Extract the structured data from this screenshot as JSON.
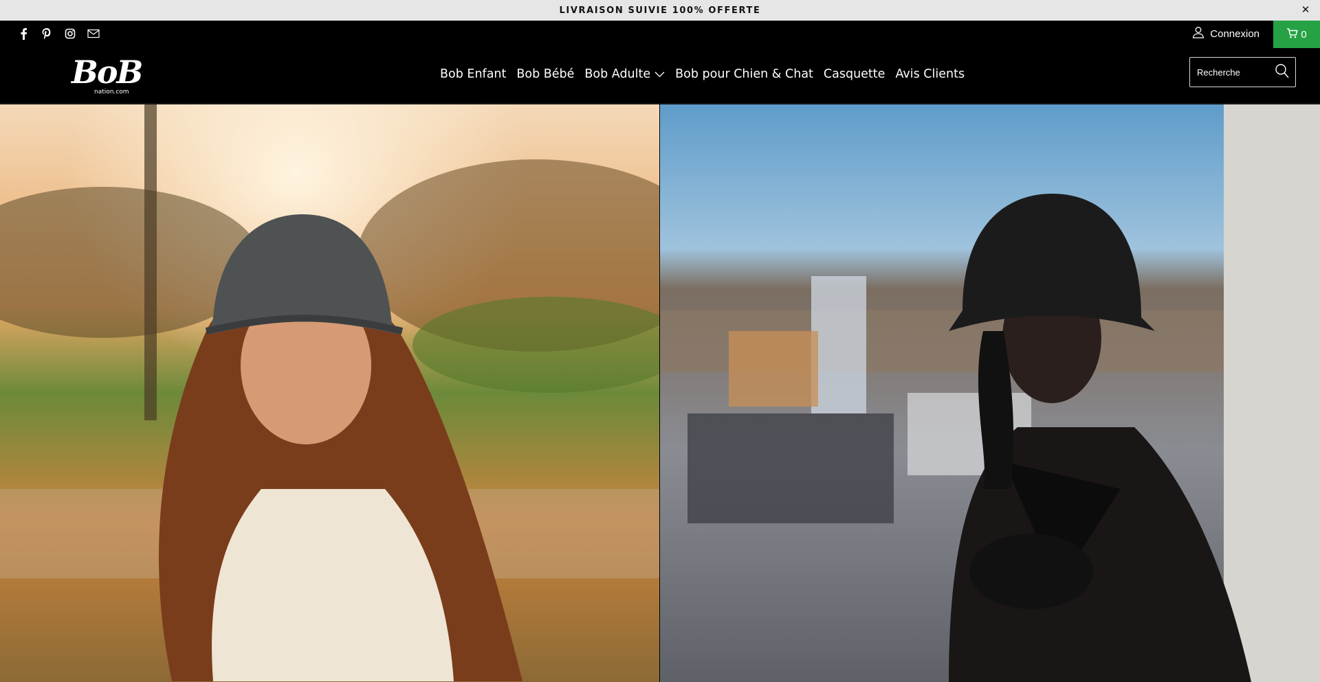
{
  "announcement": {
    "text": "LIVRAISON SUIVIE 100% OFFERTE",
    "close": "✕"
  },
  "topbar": {
    "social_icons": [
      "facebook-icon",
      "pinterest-icon",
      "instagram-icon",
      "mail-icon"
    ],
    "login_label": "Connexion",
    "cart_count": "0",
    "cart_color": "#25a244"
  },
  "header": {
    "logo_text": "BoB",
    "logo_sub": "nation.com",
    "nav": [
      {
        "label": "Bob Enfant"
      },
      {
        "label": "Bob Bébé"
      },
      {
        "label": "Bob Adulte"
      },
      {
        "label": "Bob pour Chien & Chat"
      },
      {
        "label": "Casquette"
      },
      {
        "label": "Avis Clients"
      }
    ],
    "search_placeholder": "Recherche"
  },
  "hero": {
    "left_image": "woman-curly-hair-patterned-bucket-hat",
    "right_image": "woman-black-bucket-hat-city"
  }
}
